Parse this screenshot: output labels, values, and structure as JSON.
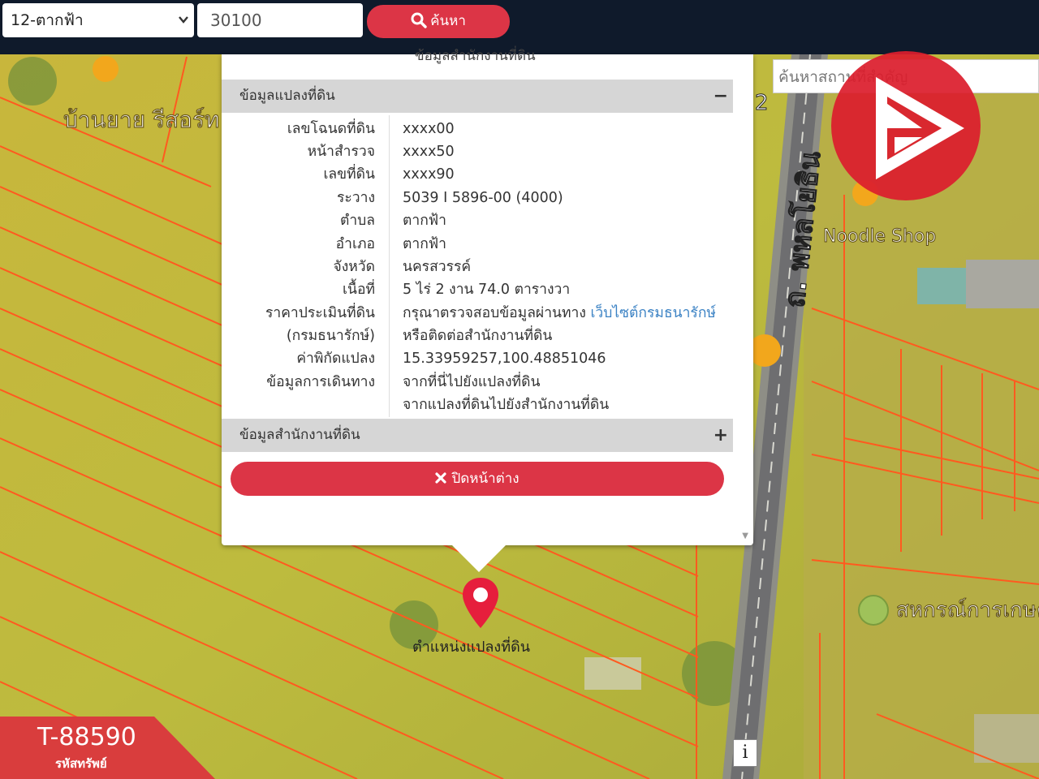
{
  "topbar": {
    "province_select": "12-ตากฟ้า",
    "postal_code": "30100",
    "search_label": "ค้นหา"
  },
  "place_search": {
    "placeholder": "ค้นหาสถานที่สำคัญ"
  },
  "map": {
    "road_label": "ถ. พหลโยธิน",
    "resort_label": "บ้านยาย รีสอร์ท ตากฟ้า",
    "shop_label": "Noodle Shop",
    "coop_label": "สหกรณ์การเกษตร ตากฟ้า พัฒนา",
    "marker_label": "ตำแหน่งแปลงที่ดิน",
    "road_number": "2"
  },
  "popup": {
    "cut_text": "ข้อมูลสำนักงานที่ดิน",
    "land_section_title": "ข้อมูลแปลงที่ดิน",
    "land_section_toggle": "−",
    "rows": [
      {
        "label": "เลขโฉนดที่ดิน",
        "value": "xxxx00"
      },
      {
        "label": "หน้าสำรวจ",
        "value": "xxxx50"
      },
      {
        "label": "เลขที่ดิน",
        "value": "xxxx90"
      },
      {
        "label": "ระวาง",
        "value": "5039 I 5896-00 (4000)"
      },
      {
        "label": "ตำบล",
        "value": "ตากฟ้า"
      },
      {
        "label": "อำเภอ",
        "value": "ตากฟ้า"
      },
      {
        "label": "จังหวัด",
        "value": "นครสวรรค์"
      },
      {
        "label": "เนื้อที่",
        "value": "5 ไร่ 2 งาน 74.0 ตารางวา"
      }
    ],
    "price_label": "ราคาประเมินที่ดิน",
    "price_label2": "(กรมธนารักษ์)",
    "price_text": "กรุณาตรวจสอบข้อมูลผ่านทาง ",
    "price_link": "เว็บไซต์กรมธนารักษ์",
    "price_text2": "หรือติดต่อสำนักงานที่ดิน",
    "coord_label": "ค่าพิกัดแปลง",
    "coord_value": "15.33959257,100.48851046",
    "travel_label": "ข้อมูลการเดินทาง",
    "travel_link1": "จากที่นี่ไปยังแปลงที่ดิน",
    "travel_link2": "จากแปลงที่ดินไปยังสำนักงานที่ดิน",
    "office_section_title": "ข้อมูลสำนักงานที่ดิน",
    "office_section_toggle": "+",
    "close_label": "ปิดหน้าต่าง"
  },
  "corner_badge": {
    "code": "T-88590",
    "caption": "รหัสทรัพย์"
  },
  "colors": {
    "accent": "#dc3546",
    "topbar": "#0f1a2b",
    "link": "#3b82c4"
  },
  "icons": [
    "search-icon",
    "close-icon",
    "map-marker-icon",
    "brand-logo-icon",
    "info-icon"
  ]
}
